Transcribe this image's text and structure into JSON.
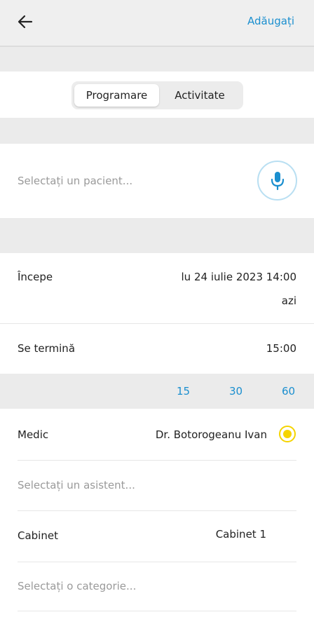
{
  "header": {
    "add_label": "Adăugați"
  },
  "tabs": {
    "active": "Programare",
    "inactive": "Activitate"
  },
  "patient": {
    "placeholder": "Selectați un pacient..."
  },
  "start": {
    "label": "Începe",
    "value": "lu 24 iulie 2023 14:00",
    "sub": "azi"
  },
  "end": {
    "label": "Se termină",
    "value": "15:00"
  },
  "durations": [
    "15",
    "30",
    "60"
  ],
  "doctor": {
    "label": "Medic",
    "value": "Dr. Botorogeanu Ivan"
  },
  "assistant": {
    "placeholder": "Selectați un asistent..."
  },
  "room": {
    "label": "Cabinet",
    "value": "Cabinet 1"
  },
  "category": {
    "placeholder": "Selectați o categorie..."
  },
  "colors": {
    "accent": "#1b8fcf",
    "radio": "#f5d400",
    "background": "#ebebeb"
  },
  "icons": {
    "back": "arrow-left-icon",
    "mic": "microphone-icon"
  }
}
